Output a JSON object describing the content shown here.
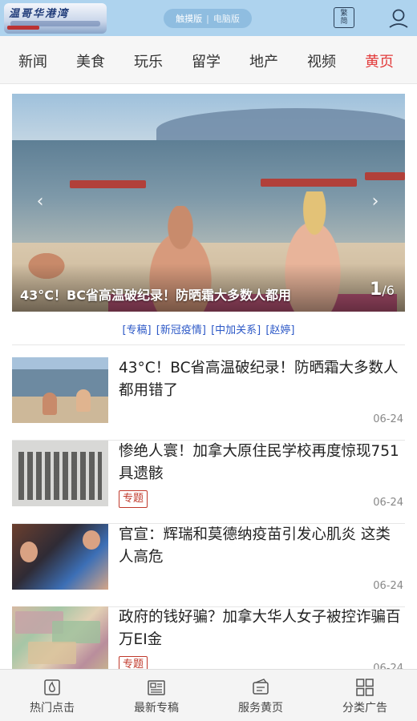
{
  "header": {
    "logo_text": "温哥华港湾",
    "version": {
      "touch": "触摸版",
      "separator": "|",
      "desktop": "电脑版"
    },
    "switch_icon_text": "繁\n简"
  },
  "nav": {
    "categories": [
      "新闻",
      "美食",
      "玩乐",
      "留学",
      "地产",
      "视频",
      "黄页"
    ],
    "active_index": 6
  },
  "carousel": {
    "caption": "43°C！BC省高温破纪录！防晒霜大多数人都用",
    "current": "1",
    "total": "/6"
  },
  "tags": [
    "[专稿]",
    "[新冠疫情]",
    "[中加关系]",
    "[赵婷]"
  ],
  "news": [
    {
      "title": "43°C！BC省高温破纪录！防晒霜大多数人都用错了",
      "date": "06-24",
      "tag": ""
    },
    {
      "title": "惨绝人寰！加拿大原住民学校再度惊现751具遗骸",
      "date": "06-24",
      "tag": "专题"
    },
    {
      "title": "官宣：辉瑞和莫德纳疫苗引发心肌炎 这类人高危",
      "date": "06-24",
      "tag": ""
    },
    {
      "title": "政府的钱好骗？加拿大华人女子被控诈骗百万EI金",
      "date": "06-24",
      "tag": "专题"
    }
  ],
  "tabbar": [
    {
      "label": "热门点击",
      "icon": "flame-icon"
    },
    {
      "label": "最新专稿",
      "icon": "newspaper-icon"
    },
    {
      "label": "服务黄页",
      "icon": "card-icon"
    },
    {
      "label": "分类广告",
      "icon": "grid-icon"
    }
  ],
  "colors": {
    "header_bg": "#aed3ee",
    "active_nav": "#e23a3a",
    "tag_link": "#2d59c7",
    "special_tag": "#c0392b"
  }
}
